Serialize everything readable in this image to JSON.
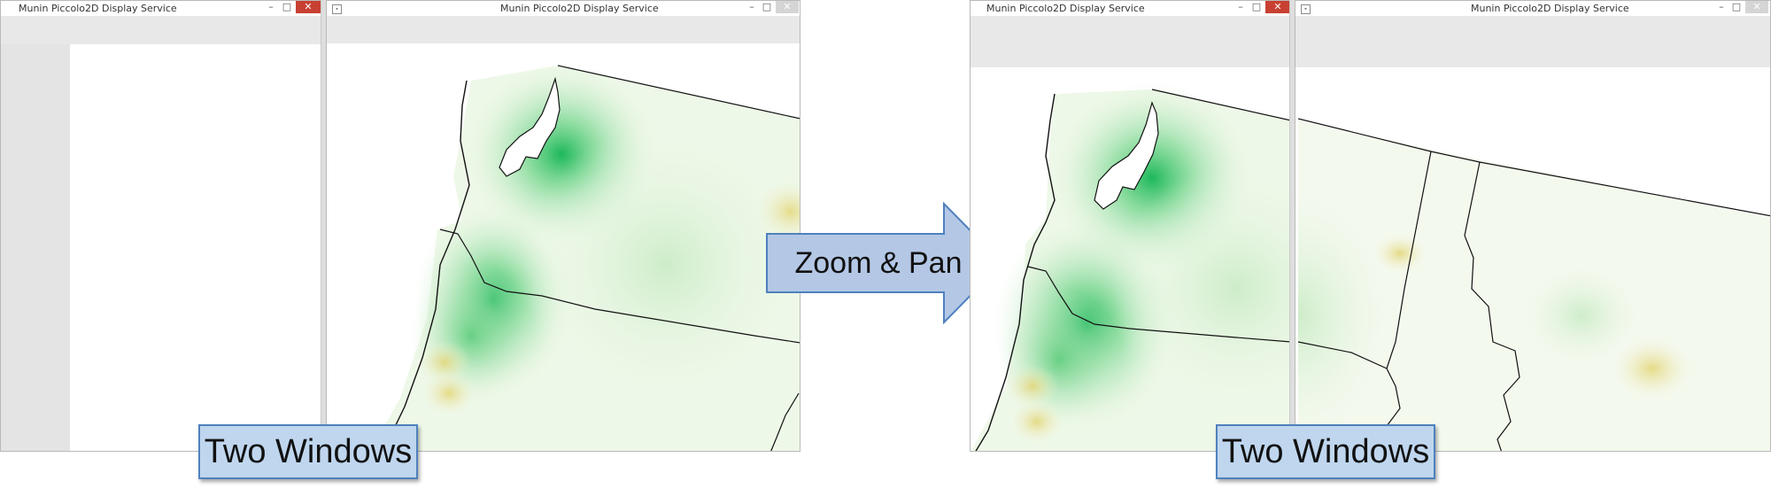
{
  "window_title": "Munin Piccolo2D Display Service",
  "callouts": {
    "left_label": "Two Windows",
    "right_label": "Two Windows",
    "arrow_label": "Zoom & Pan"
  },
  "window_controls": {
    "minimize": "–",
    "maximize": "□",
    "close": "✕"
  },
  "colors": {
    "close_active": "#c84031",
    "callout_fill": "#bfd6ee",
    "callout_border": "#4f81bd",
    "arrow_fill": "#b4c8e6"
  }
}
